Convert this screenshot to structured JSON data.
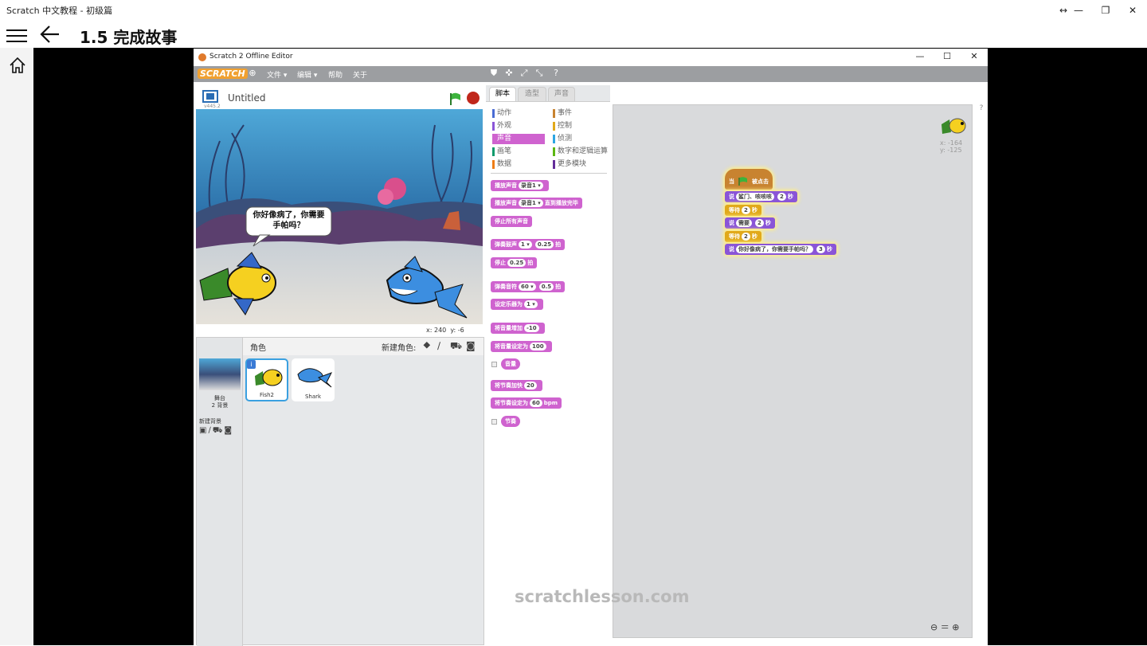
{
  "app": {
    "window_title": "Scratch 中文教程 - 初级篇",
    "lesson_title": "1.5  完成故事"
  },
  "editor": {
    "window_title": "Scratch 2 Offline Editor",
    "logo": "SCRATCH",
    "menu": [
      "文件 ▾",
      "编辑 ▾",
      "帮助",
      "关于"
    ],
    "project_title": "Untitled",
    "version": "v445.2",
    "speech_bubble": "你好像病了，你需要手帕吗？",
    "coords": {
      "x_label": "x:",
      "x": "240",
      "y_label": "y:",
      "y": "-6"
    }
  },
  "sprites": {
    "header_label": "角色",
    "new_sprite_label": "新建角色:",
    "stage_label": "舞台",
    "stage_backdrops": "2 背景",
    "new_backdrop_label": "新建背景",
    "items": [
      {
        "name": "Fish2",
        "selected": true
      },
      {
        "name": "Shark",
        "selected": false
      }
    ]
  },
  "tabs": [
    "脚本",
    "造型",
    "声音"
  ],
  "categories": {
    "left": [
      {
        "label": "动作",
        "color": "#4a6cd4"
      },
      {
        "label": "外观",
        "color": "#8a55d7"
      },
      {
        "label": "声音",
        "color": "#cf63cf",
        "selected": true
      },
      {
        "label": "画笔",
        "color": "#0e9a6c"
      },
      {
        "label": "数据",
        "color": "#ee7d16"
      }
    ],
    "right": [
      {
        "label": "事件",
        "color": "#c88330"
      },
      {
        "label": "控制",
        "color": "#e1a91a"
      },
      {
        "label": "侦测",
        "color": "#2ca5e2"
      },
      {
        "label": "数字和逻辑运算",
        "color": "#5cb712"
      },
      {
        "label": "更多模块",
        "color": "#632d99"
      }
    ]
  },
  "palette_blocks": [
    {
      "text": "播放声音",
      "inputs": [
        "录音1 ▾"
      ]
    },
    {
      "text": "播放声音",
      "inputs": [
        "录音1 ▾"
      ],
      "suffix": "直到播放完毕"
    },
    {
      "text": "停止所有声音"
    },
    {
      "text": "弹奏鼓声",
      "inputs": [
        "1 ▾",
        "0.25"
      ],
      "suffix": "拍"
    },
    {
      "text": "停止",
      "inputs": [
        "0.25"
      ],
      "suffix": "拍"
    },
    {
      "text": "弹奏音符",
      "inputs": [
        "60 ▾",
        "0.5"
      ],
      "suffix": "拍"
    },
    {
      "text": "设定乐器为",
      "inputs": [
        "1 ▾"
      ]
    },
    {
      "text": "将音量增加",
      "inputs": [
        "-10"
      ]
    },
    {
      "text": "将音量设定为",
      "inputs": [
        "100"
      ]
    },
    {
      "text": "音量",
      "reporter": true
    },
    {
      "text": "将节奏加快",
      "inputs": [
        "20"
      ]
    },
    {
      "text": "将节奏设定为",
      "inputs": [
        "60"
      ],
      "suffix": "bpm"
    },
    {
      "text": "节奏",
      "reporter": true
    }
  ],
  "script": {
    "hat": {
      "pre": "当",
      "post": "被点击",
      "color": "#c88330"
    },
    "blocks": [
      {
        "pre": "说",
        "input1": "鲨门、咳咳咳",
        "input2": "2",
        "post": "秒",
        "color": "#8a55d7"
      },
      {
        "pre": "等待",
        "input1": "2",
        "post": "秒",
        "color": "#e1a91a"
      },
      {
        "pre": "说",
        "input1": "需要",
        "input2": "2",
        "post": "秒",
        "color": "#8a55d7"
      },
      {
        "pre": "等待",
        "input1": "2",
        "post": "秒",
        "color": "#e1a91a"
      },
      {
        "pre": "说",
        "input1": "你好像病了，你需要手帕吗？",
        "input2": "3",
        "post": "秒",
        "color": "#8a55d7"
      }
    ],
    "sprite_xy": {
      "x": "x: -164",
      "y": "y: -125"
    }
  },
  "watermark": "scratchlesson.com"
}
